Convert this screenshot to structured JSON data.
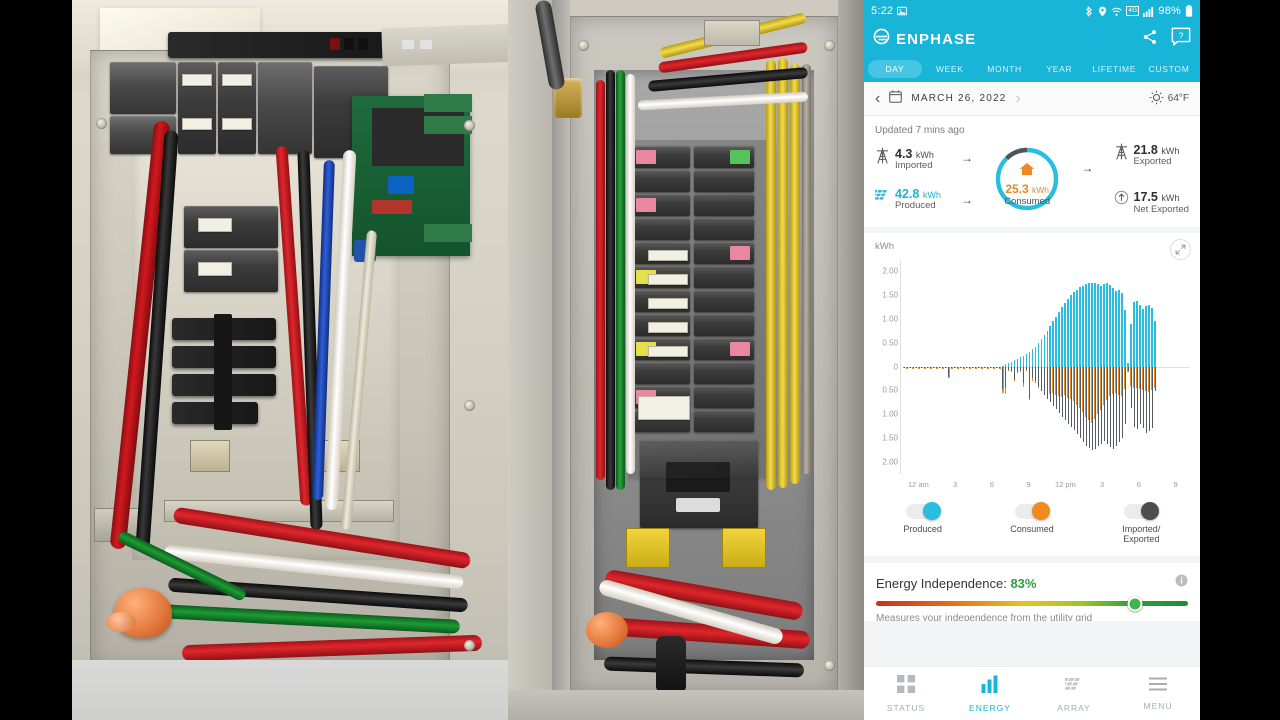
{
  "statusbar": {
    "time": "5:22",
    "battery": "98%",
    "icons": [
      "image-icon",
      "bluetooth-icon",
      "location-icon",
      "wifi-icon",
      "4g-icon",
      "signal-icon",
      "battery-icon"
    ],
    "network_label": "4G"
  },
  "appbar": {
    "brand": "ENPHASE",
    "share_icon": "share-icon",
    "help_icon": "help-icon"
  },
  "tabs": [
    {
      "label": "DAY",
      "active": true
    },
    {
      "label": "WEEK",
      "active": false
    },
    {
      "label": "MONTH",
      "active": false
    },
    {
      "label": "YEAR",
      "active": false
    },
    {
      "label": "LIFETIME",
      "active": false
    },
    {
      "label": "CUSTOM",
      "active": false
    }
  ],
  "datebar": {
    "prev_label": "‹",
    "next_label": "›",
    "date": "MARCH 26, 2022",
    "temperature": "64°F",
    "weather_icon": "sun-icon",
    "calendar_icon": "calendar-icon"
  },
  "summary": {
    "updated": "Updated 7 mins ago",
    "imported": {
      "value": "4.3",
      "unit": "kWh",
      "label": "Imported",
      "icon": "grid-tower-icon"
    },
    "produced": {
      "value": "42.8",
      "unit": "kWh",
      "label": "Produced",
      "icon": "solar-panel-icon"
    },
    "consumed": {
      "value": "25.3",
      "unit": "kWh",
      "label": "Consumed",
      "icon": "home-icon"
    },
    "exported": {
      "value": "21.8",
      "unit": "kWh",
      "label": "Exported",
      "icon": "grid-tower-icon"
    },
    "net_exported": {
      "value": "17.5",
      "unit": "kWh",
      "label": "Net Exported",
      "icon": "up-arrow-circle-icon"
    },
    "arrow": "→"
  },
  "chart_card": {
    "unit_label": "kWh",
    "expand_icon": "expand-icon"
  },
  "chart_data": {
    "type": "bar",
    "title": "",
    "xlabel": "",
    "ylabel": "kWh",
    "ylim": [
      -2.25,
      2.25
    ],
    "ytick_labels": [
      "2.00",
      "1.50",
      "1.00",
      "0.50",
      "0",
      "0.50",
      "1.00",
      "1.50",
      "2.00"
    ],
    "ytick_values": [
      2.0,
      1.5,
      1.0,
      0.5,
      0,
      -0.5,
      -1.0,
      -1.5,
      -2.0
    ],
    "xtick_labels": [
      "12 am",
      "3",
      "6",
      "9",
      "12 pm",
      "3",
      "6",
      "9"
    ],
    "grid": false,
    "legend_position": "below",
    "interval_minutes": 15,
    "series": [
      {
        "name": "Produced",
        "color": "#29bde0",
        "direction": "up",
        "values": [
          0,
          0,
          0,
          0,
          0,
          0,
          0,
          0,
          0,
          0,
          0,
          0,
          0,
          0,
          0,
          0,
          0,
          0,
          0,
          0,
          0,
          0,
          0,
          0,
          0,
          0,
          0,
          0,
          0,
          0,
          0,
          0,
          0,
          0.02,
          0.05,
          0.08,
          0.1,
          0.13,
          0.16,
          0.2,
          0.22,
          0.26,
          0.3,
          0.36,
          0.42,
          0.5,
          0.58,
          0.66,
          0.75,
          0.85,
          0.95,
          1.05,
          1.15,
          1.25,
          1.34,
          1.42,
          1.5,
          1.56,
          1.62,
          1.67,
          1.7,
          1.73,
          1.75,
          1.76,
          1.75,
          1.73,
          1.7,
          1.73,
          1.75,
          1.72,
          1.66,
          1.58,
          1.62,
          1.55,
          1.18,
          0.08,
          0.9,
          1.35,
          1.38,
          1.3,
          1.22,
          1.28,
          1.3,
          1.24,
          0.95,
          0,
          0,
          0,
          0,
          0,
          0,
          0,
          0,
          0,
          0,
          0
        ]
      },
      {
        "name": "Consumed",
        "color": "#f08a1e",
        "direction": "down",
        "values": [
          0.04,
          0.05,
          0.04,
          0.05,
          0.04,
          0.05,
          0.04,
          0.05,
          0.04,
          0.05,
          0.04,
          0.05,
          0.04,
          0.05,
          0.04,
          0.24,
          0.05,
          0.04,
          0.05,
          0.04,
          0.05,
          0.04,
          0.05,
          0.04,
          0.05,
          0.04,
          0.05,
          0.04,
          0.05,
          0.04,
          0.05,
          0.04,
          0.05,
          0.55,
          0.58,
          0.1,
          0.12,
          0.3,
          0.14,
          0.12,
          0.42,
          0.1,
          0.7,
          0.3,
          0.35,
          0.44,
          0.5,
          0.52,
          0.55,
          0.58,
          0.56,
          0.6,
          0.62,
          0.64,
          0.6,
          0.66,
          0.68,
          0.72,
          0.8,
          0.88,
          0.95,
          1.05,
          1.12,
          1.18,
          1.1,
          1.0,
          0.92,
          0.8,
          0.7,
          0.62,
          0.58,
          0.55,
          0.6,
          0.62,
          0.48,
          0.12,
          0.4,
          0.44,
          0.46,
          0.48,
          0.5,
          0.52,
          0.54,
          0.5,
          0.46,
          0,
          0,
          0,
          0,
          0,
          0,
          0,
          0,
          0,
          0,
          0
        ]
      },
      {
        "name": "Imported/Exported",
        "color": "#525a63",
        "direction": "both",
        "values": [
          0.02,
          0.02,
          0.02,
          0.02,
          0.02,
          0.02,
          0.02,
          0.02,
          0.02,
          0.02,
          0.02,
          0.02,
          0.02,
          0.02,
          0.02,
          0.22,
          0.02,
          0.02,
          0.02,
          0.02,
          0.02,
          0.02,
          0.02,
          0.02,
          0.02,
          0.02,
          0.02,
          0.02,
          0.02,
          0.02,
          0.02,
          0.02,
          0.02,
          0.47,
          0.44,
          0.08,
          0.1,
          0.28,
          0.12,
          0.1,
          0.35,
          0.08,
          0.68,
          0.25,
          0.3,
          0.42,
          0.52,
          0.6,
          0.68,
          0.75,
          0.82,
          0.9,
          0.98,
          1.06,
          1.12,
          1.2,
          1.28,
          1.34,
          1.42,
          1.5,
          1.58,
          1.66,
          1.72,
          1.76,
          1.74,
          1.68,
          1.62,
          1.56,
          1.62,
          1.7,
          1.74,
          1.66,
          1.58,
          1.5,
          1.2,
          0.1,
          0.88,
          1.28,
          1.32,
          1.2,
          1.3,
          1.4,
          1.36,
          1.3,
          0.52,
          0,
          0,
          0,
          0,
          0,
          0,
          0,
          0,
          0,
          0,
          0
        ]
      }
    ]
  },
  "legend": [
    {
      "label": "Produced",
      "color": "#29bde0",
      "on": true
    },
    {
      "label": "Consumed",
      "color": "#f08a1e",
      "on": true
    },
    {
      "label": "Imported/\nExported",
      "color": "#4a4f54",
      "on": true
    }
  ],
  "energy_independence": {
    "title_prefix": "Energy Independence: ",
    "value": "83%",
    "percent": 83,
    "info_icon": "info-icon",
    "subtitle": "Measures your independence from the utility grid"
  },
  "bottom_nav": [
    {
      "label": "STATUS",
      "icon": "grid-squares-icon",
      "active": false
    },
    {
      "label": "ENERGY",
      "icon": "bar-chart-icon",
      "active": true
    },
    {
      "label": "ARRAY",
      "icon": "solar-panel-icon",
      "active": false
    },
    {
      "label": "MENU",
      "icon": "hamburger-icon",
      "active": false
    }
  ],
  "colors": {
    "brand": "#19b5d8",
    "produced": "#29bde0",
    "consumed": "#f08a1e",
    "grid": "#525a63",
    "independence": "#2f9e3e"
  },
  "photos": {
    "left": "open electrical subpanel with breakers, gateway board and colored wiring",
    "right": "open main load center panel with many breakers and labeled circuit wiring"
  }
}
